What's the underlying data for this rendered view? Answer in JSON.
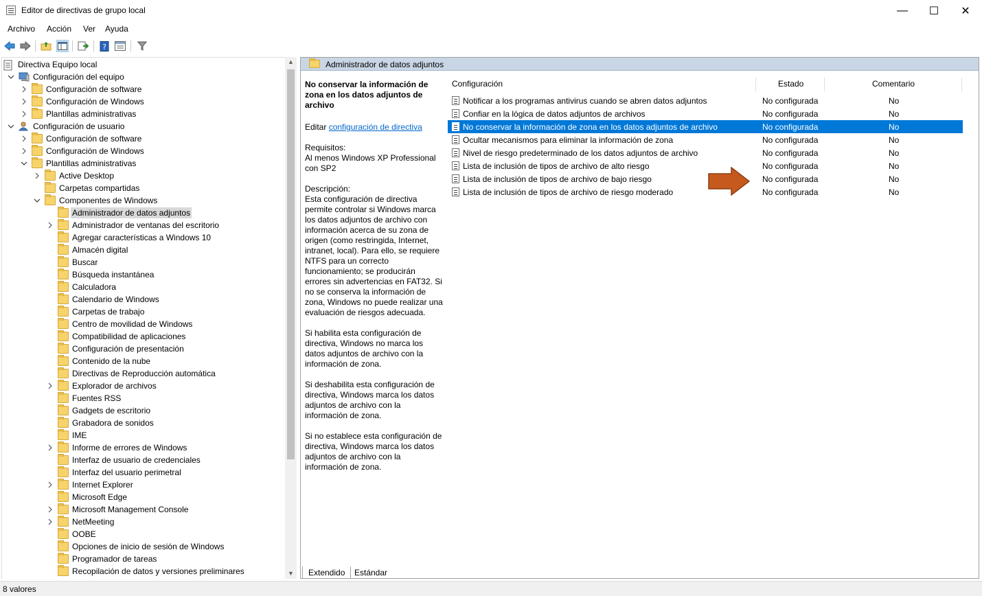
{
  "window": {
    "title": "Editor de directivas de grupo local",
    "minimize": "—",
    "maximize": "☐",
    "close": "✕"
  },
  "menu": [
    "Archivo",
    "Acción",
    "Ver",
    "Ayuda"
  ],
  "toolbar": {
    "icons": [
      "back-icon",
      "forward-icon",
      "up-folder-icon",
      "show-hide-tree-icon",
      "export-list-icon",
      "help-icon",
      "properties-icon",
      "filter-icon"
    ]
  },
  "tree": [
    {
      "label": "Directiva Equipo local",
      "level": 0,
      "chev": "none",
      "icon": "policy"
    },
    {
      "label": "Configuración del equipo",
      "level": 1,
      "chev": "down",
      "icon": "computer"
    },
    {
      "label": "Configuración de software",
      "level": 2,
      "chev": "right",
      "icon": "folder"
    },
    {
      "label": "Configuración de Windows",
      "level": 2,
      "chev": "right",
      "icon": "folder"
    },
    {
      "label": "Plantillas administrativas",
      "level": 2,
      "chev": "right",
      "icon": "folder"
    },
    {
      "label": "Configuración de usuario",
      "level": 1,
      "chev": "down",
      "icon": "user"
    },
    {
      "label": "Configuración de software",
      "level": 2,
      "chev": "right",
      "icon": "folder"
    },
    {
      "label": "Configuración de Windows",
      "level": 2,
      "chev": "right",
      "icon": "folder"
    },
    {
      "label": "Plantillas administrativas",
      "level": 2,
      "chev": "down",
      "icon": "folder"
    },
    {
      "label": "Active Desktop",
      "level": 3,
      "chev": "right",
      "icon": "folder"
    },
    {
      "label": "Carpetas compartidas",
      "level": 3,
      "chev": "none",
      "icon": "folder"
    },
    {
      "label": "Componentes de Windows",
      "level": 3,
      "chev": "down",
      "icon": "folder"
    },
    {
      "label": "Administrador de datos adjuntos",
      "level": 4,
      "chev": "none",
      "icon": "folder",
      "selected": true
    },
    {
      "label": "Administrador de ventanas del escritorio",
      "level": 4,
      "chev": "right",
      "icon": "folder"
    },
    {
      "label": "Agregar características a Windows 10",
      "level": 4,
      "chev": "none",
      "icon": "folder"
    },
    {
      "label": "Almacén digital",
      "level": 4,
      "chev": "none",
      "icon": "folder"
    },
    {
      "label": "Buscar",
      "level": 4,
      "chev": "none",
      "icon": "folder"
    },
    {
      "label": "Búsqueda instantánea",
      "level": 4,
      "chev": "none",
      "icon": "folder"
    },
    {
      "label": "Calculadora",
      "level": 4,
      "chev": "none",
      "icon": "folder"
    },
    {
      "label": "Calendario de Windows",
      "level": 4,
      "chev": "none",
      "icon": "folder"
    },
    {
      "label": "Carpetas de trabajo",
      "level": 4,
      "chev": "none",
      "icon": "folder"
    },
    {
      "label": "Centro de movilidad de Windows",
      "level": 4,
      "chev": "none",
      "icon": "folder"
    },
    {
      "label": "Compatibilidad de aplicaciones",
      "level": 4,
      "chev": "none",
      "icon": "folder"
    },
    {
      "label": "Configuración de presentación",
      "level": 4,
      "chev": "none",
      "icon": "folder"
    },
    {
      "label": "Contenido de la nube",
      "level": 4,
      "chev": "none",
      "icon": "folder"
    },
    {
      "label": "Directivas de Reproducción automática",
      "level": 4,
      "chev": "none",
      "icon": "folder"
    },
    {
      "label": "Explorador de archivos",
      "level": 4,
      "chev": "right",
      "icon": "folder"
    },
    {
      "label": "Fuentes RSS",
      "level": 4,
      "chev": "none",
      "icon": "folder"
    },
    {
      "label": "Gadgets de escritorio",
      "level": 4,
      "chev": "none",
      "icon": "folder"
    },
    {
      "label": "Grabadora de sonidos",
      "level": 4,
      "chev": "none",
      "icon": "folder"
    },
    {
      "label": "IME",
      "level": 4,
      "chev": "none",
      "icon": "folder"
    },
    {
      "label": "Informe de errores de Windows",
      "level": 4,
      "chev": "right",
      "icon": "folder"
    },
    {
      "label": "Interfaz de usuario de credenciales",
      "level": 4,
      "chev": "none",
      "icon": "folder"
    },
    {
      "label": "Interfaz del usuario perimetral",
      "level": 4,
      "chev": "none",
      "icon": "folder"
    },
    {
      "label": "Internet Explorer",
      "level": 4,
      "chev": "right",
      "icon": "folder"
    },
    {
      "label": "Microsoft Edge",
      "level": 4,
      "chev": "none",
      "icon": "folder"
    },
    {
      "label": "Microsoft Management Console",
      "level": 4,
      "chev": "right",
      "icon": "folder"
    },
    {
      "label": "NetMeeting",
      "level": 4,
      "chev": "right",
      "icon": "folder"
    },
    {
      "label": "OOBE",
      "level": 4,
      "chev": "none",
      "icon": "folder"
    },
    {
      "label": "Opciones de inicio de sesión de Windows",
      "level": 4,
      "chev": "none",
      "icon": "folder"
    },
    {
      "label": "Programador de tareas",
      "level": 4,
      "chev": "none",
      "icon": "folder"
    },
    {
      "label": "Recopilación de datos y versiones preliminares",
      "level": 4,
      "chev": "none",
      "icon": "folder"
    }
  ],
  "right": {
    "header": "Administrador de datos adjuntos",
    "description": {
      "title": "No conservar la información de zona en los datos adjuntos de archivo",
      "edit_prefix": "Editar ",
      "edit_link": "configuración de directiva",
      "paragraphs": [
        "Requisitos:\nAl menos Windows XP Professional con SP2",
        "Descripción:\nEsta configuración de directiva permite controlar si Windows marca los datos adjuntos de archivo con información acerca de su zona de origen (como restringida, Internet, intranet, local). Para ello, se requiere NTFS para un correcto funcionamiento; se producirán errores sin advertencias en FAT32. Si no se conserva la información de zona, Windows no puede realizar una evaluación de riesgos adecuada.",
        "Si habilita esta configuración de directiva, Windows no marca los datos adjuntos de archivo con la información de zona.",
        "Si deshabilita esta configuración de directiva, Windows marca los datos adjuntos de archivo con la información de zona.",
        "Si no establece esta configuración de directiva, Windows marca los datos adjuntos de archivo con la información de zona."
      ]
    },
    "columns": {
      "setting": "Configuración",
      "state": "Estado",
      "comment": "Comentario"
    },
    "rows": [
      {
        "setting": "Notificar a los programas antivirus cuando se abren datos adjuntos",
        "state": "No configurada",
        "comment": "No"
      },
      {
        "setting": "Confiar en la lógica de datos adjuntos de archivos",
        "state": "No configurada",
        "comment": "No"
      },
      {
        "setting": "No conservar la información de zona en los datos adjuntos de archivo",
        "state": "No configurada",
        "comment": "No",
        "selected": true
      },
      {
        "setting": "Ocultar mecanismos para eliminar la información de zona",
        "state": "No configurada",
        "comment": "No"
      },
      {
        "setting": "Nivel de riesgo predeterminado de los datos adjuntos de archivo",
        "state": "No configurada",
        "comment": "No"
      },
      {
        "setting": "Lista de inclusión de tipos de archivo de alto riesgo",
        "state": "No configurada",
        "comment": "No"
      },
      {
        "setting": "Lista de inclusión de tipos de archivo de bajo riesgo",
        "state": "No configurada",
        "comment": "No"
      },
      {
        "setting": "Lista de inclusión de tipos de archivo de riesgo moderado",
        "state": "No configurada",
        "comment": "No"
      }
    ]
  },
  "tabs": [
    "Extendido",
    "Estándar"
  ],
  "status": "8 valores",
  "colors": {
    "selection": "#0078d7",
    "header_band": "#c8d6e5",
    "arrow": "#c65a1e"
  }
}
